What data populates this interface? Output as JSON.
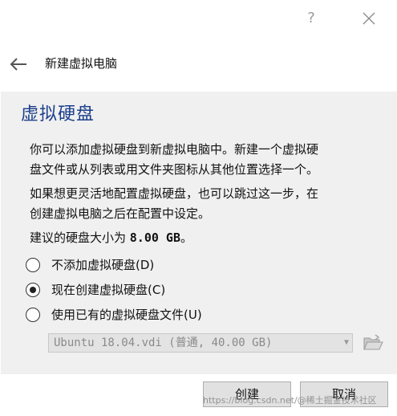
{
  "titlebar": {
    "help_label": "?",
    "close_icon": "close-icon"
  },
  "header": {
    "back_icon": "back-arrow-icon",
    "wizard_title": "新建虚拟电脑"
  },
  "page": {
    "title": "虚拟硬盘",
    "para1_line1": "你可以添加虚拟硬盘到新虚拟电脑中。新建一个虚拟硬",
    "para1_line2": "盘文件或从列表或用文件夹图标从其他位置选择一个。",
    "para2_line1": "如果想更灵活地配置虚拟硬盘，也可以跳过这一步，在",
    "para2_line2": "创建虚拟电脑之后在配置中设定。",
    "recommend_prefix": "建议的硬盘大小为 ",
    "recommend_size": "8.00 GB",
    "recommend_suffix": "。"
  },
  "options": [
    {
      "label": "不添加虚拟硬盘(D)",
      "selected": false
    },
    {
      "label": "现在创建虚拟硬盘(C)",
      "selected": true
    },
    {
      "label": "使用已有的虚拟硬盘文件(U)",
      "selected": false
    }
  ],
  "disk_select": {
    "value": "Ubuntu 18.04.vdi (普通, 40.00 GB)",
    "disabled": true
  },
  "folder_icon": "folder-open-icon",
  "buttons": {
    "create": "创建",
    "cancel": "取消"
  },
  "watermark": "https://blog.csdn.net/@稀土掘金技术社区"
}
